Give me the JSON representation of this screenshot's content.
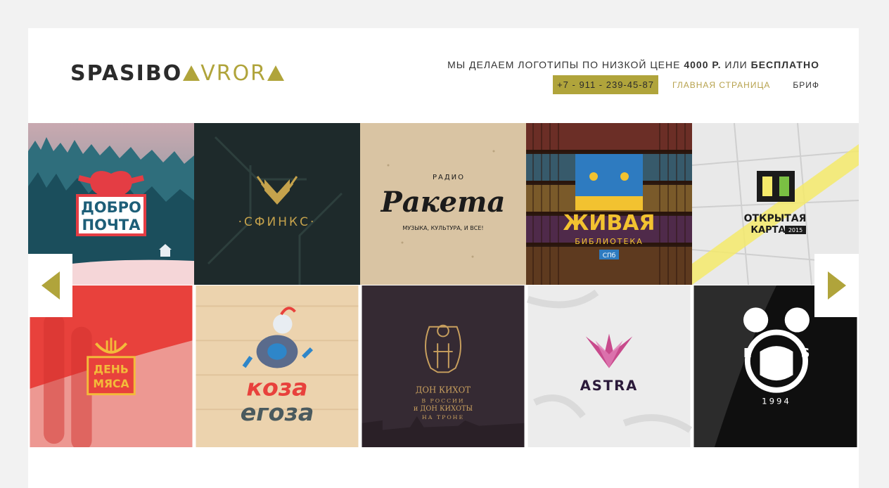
{
  "header": {
    "logo_first": "SPASIBO",
    "logo_second": "VROR",
    "tagline_part1": "МЫ ДЕЛАЕМ ЛОГОТИПЫ ПО НИЗКОЙ ЦЕНЕ ",
    "tagline_price": "4000 Р.",
    "tagline_part2": " ИЛИ ",
    "tagline_free": "БЕСПЛАТНО",
    "phone": "+7 - 911 - 239-45-87",
    "nav_home": "ГЛАВНАЯ СТРАНИЦА",
    "nav_brief": "БРИФ"
  },
  "colors": {
    "accent": "#b0a43b",
    "text": "#2b2b2b",
    "background": "#f2f2f2"
  },
  "portfolio": {
    "row1": [
      {
        "line1": "ДОБРО",
        "line2": "ПОЧТА"
      },
      {
        "line1": "·СФИНКС·"
      },
      {
        "top": "РАДИО",
        "line1": "Ракета",
        "bottom": "МУЗЫКА, КУЛЬТУРА, И ВСЕ!"
      },
      {
        "line1": "ЖИВАЯ",
        "line2": "БИБЛИОТЕКА",
        "badge": "СПб"
      },
      {
        "line1": "ОТКРЫТАЯ",
        "line2": "КАРТА",
        "badge": "2015"
      }
    ],
    "row2": [
      {
        "line1": "ДЕНЬ",
        "line2": "МЯСА"
      },
      {
        "line1": "коза",
        "line2": "егоза"
      },
      {
        "line1": "ДОН КИХОТ",
        "line2": "В РОССИИ",
        "line3": "и ДОН КИХОТЫ",
        "line4": "НА ТРОНЕ"
      },
      {
        "line1": "ASTRA"
      },
      {
        "letter_left": "E",
        "letter_right": "S",
        "year": "1994"
      }
    ]
  },
  "slider": {
    "prev_icon": "triangle-left-icon",
    "next_icon": "triangle-right-icon"
  }
}
